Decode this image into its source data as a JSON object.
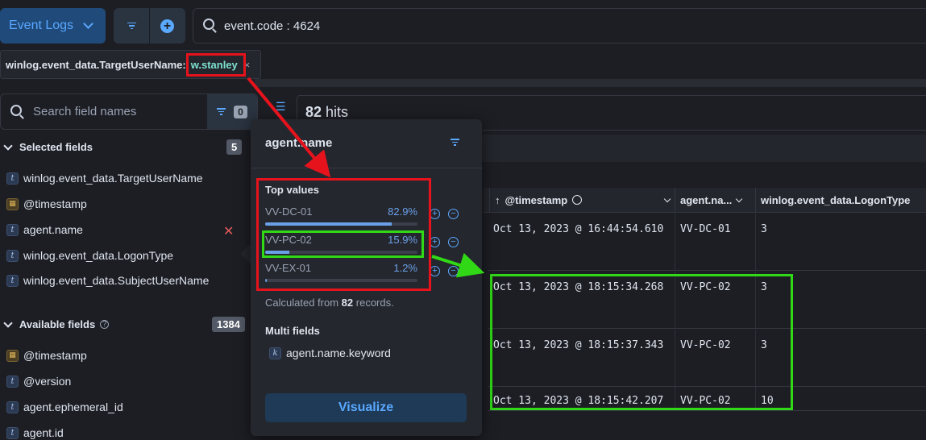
{
  "top_bar": {
    "dataview_label": "Event Logs",
    "query": "event.code : 4624"
  },
  "filter_pill": {
    "field": "winlog.event_data.TargetUserName:",
    "value": "w.stanley",
    "remove": "×"
  },
  "sidebar": {
    "search_placeholder": "Search field names",
    "filter_count": "0",
    "selected": {
      "title": "Selected fields",
      "count": "5",
      "items": [
        {
          "type": "t",
          "label": "winlog.event_data.TargetUserName"
        },
        {
          "type": "date",
          "label": "@timestamp"
        },
        {
          "type": "t",
          "label": "agent.name",
          "remove": "✕"
        },
        {
          "type": "t",
          "label": "winlog.event_data.LogonType"
        },
        {
          "type": "t",
          "label": "winlog.event_data.SubjectUserName"
        }
      ]
    },
    "available": {
      "title": "Available fields",
      "help": "?",
      "count": "1384",
      "items": [
        {
          "type": "date",
          "label": "@timestamp"
        },
        {
          "type": "t",
          "label": "@version"
        },
        {
          "type": "t",
          "label": "agent.ephemeral_id"
        },
        {
          "type": "t",
          "label": "agent.id"
        }
      ]
    }
  },
  "hits": {
    "count": "82",
    "label": "hits"
  },
  "popover": {
    "title": "agent.name",
    "top_values_title": "Top values",
    "top_values": [
      {
        "label": "VV-DC-01",
        "pct": "82.9%",
        "fraction": 0.829
      },
      {
        "label": "VV-PC-02",
        "pct": "15.9%",
        "fraction": 0.159
      },
      {
        "label": "VV-EX-01",
        "pct": "1.2%",
        "fraction": 0.012
      }
    ],
    "calc_prefix": "Calculated from",
    "calc_count": "82",
    "calc_suffix": "records.",
    "multi_title": "Multi fields",
    "multi_item": "agent.name.keyword",
    "visualize": "Visualize"
  },
  "grid": {
    "columns": [
      "@timestamp",
      "agent.na...",
      "winlog.event_data.LogonType"
    ],
    "rows": [
      [
        "Oct 13, 2023 @ 16:44:54.610",
        "VV-DC-01",
        "3"
      ],
      [
        "Oct 13, 2023 @ 18:15:34.268",
        "VV-PC-02",
        "3"
      ],
      [
        "Oct 13, 2023 @ 18:15:37.343",
        "VV-PC-02",
        "3"
      ],
      [
        "Oct 13, 2023 @ 18:15:42.207",
        "VV-PC-02",
        "10"
      ]
    ]
  },
  "colors": {
    "annotation_red": "#e6131c",
    "annotation_green": "#31d816",
    "accent_blue": "#5aa8ff"
  }
}
